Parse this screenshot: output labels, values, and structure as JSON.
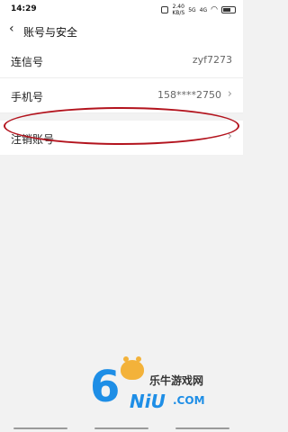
{
  "status_bar": {
    "time": "14:29",
    "net_speed": "2.40",
    "net_unit": "KB/S",
    "signal1": "5G",
    "signal2": "4G"
  },
  "header": {
    "back_icon": "chevron-left-icon",
    "title": "账号与安全"
  },
  "rows": [
    {
      "label": "连信号",
      "value": "zyf7273",
      "has_arrow": false
    },
    {
      "label": "手机号",
      "value": "158****2750",
      "has_arrow": true
    },
    {
      "label": "注销账号",
      "value": "",
      "has_arrow": true
    }
  ],
  "highlight": {
    "color": "#b3141e",
    "target": "注销账号"
  },
  "watermark": {
    "digit": "6",
    "brand": "乐牛游戏网",
    "letters": "NiU",
    "domain": ".COM"
  },
  "colors": {
    "background": "#f2f2f2",
    "panel": "#ffffff",
    "arrow": "#999999",
    "watermark_blue": "#1e8ee6"
  }
}
